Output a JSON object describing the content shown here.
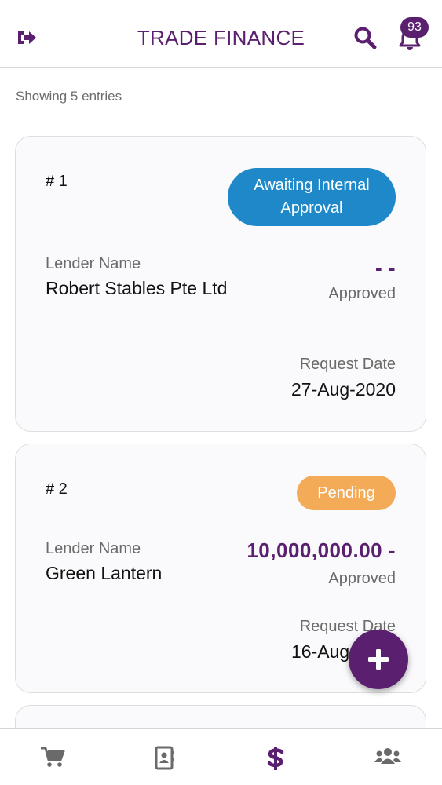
{
  "header": {
    "title": "TRADE FINANCE",
    "notification_count": "93"
  },
  "icons": {
    "logout": "sign-out-icon",
    "search": "search-icon",
    "notifications": "bell-icon",
    "add": "plus-icon",
    "nav": [
      "cart-icon",
      "contacts-icon",
      "dollar-icon",
      "users-icon"
    ]
  },
  "colors": {
    "brand": "#5b1f70",
    "status_blue": "#1e88c8",
    "status_orange": "#f4ab58"
  },
  "list": {
    "entries_text": "Showing 5 entries",
    "cards": [
      {
        "number": "# 1",
        "status": "Awaiting Internal Approval",
        "lender_label": "Lender Name",
        "lender_name": "Robert Stables Pte Ltd",
        "amount": "- -",
        "approved_label": "Approved",
        "request_label": "Request Date",
        "request_date": "27-Aug-2020"
      },
      {
        "number": "# 2",
        "status": "Pending",
        "lender_label": "Lender Name",
        "lender_name": "Green Lantern",
        "amount": "10,000,000.00 -",
        "approved_label": "Approved",
        "request_label": "Request Date",
        "request_date": "16-Aug-2020"
      }
    ]
  }
}
